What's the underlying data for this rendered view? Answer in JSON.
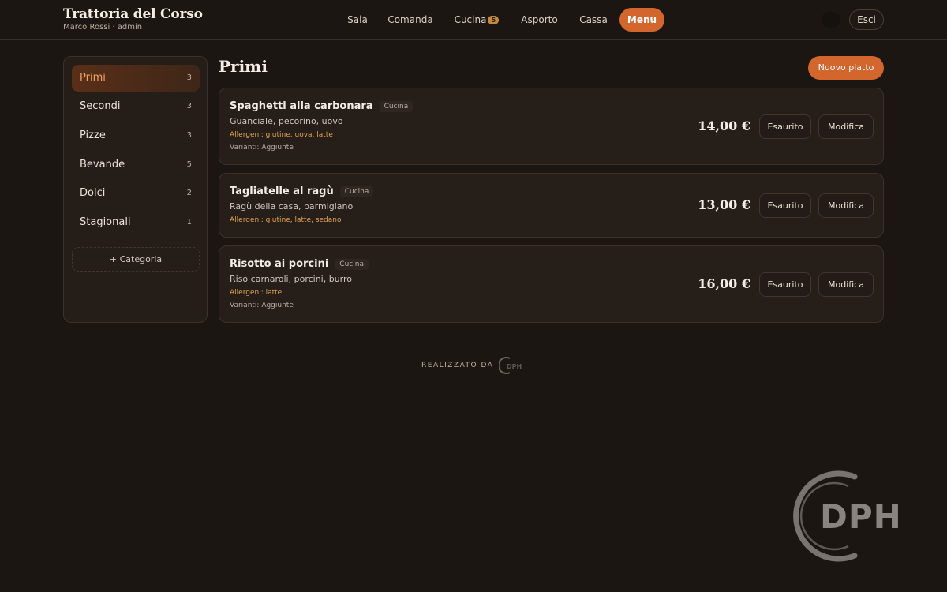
{
  "header": {
    "title": "Trattoria del Corso",
    "subtitle": "Marco Rossi · admin",
    "nav": [
      {
        "label": "Sala"
      },
      {
        "label": "Comanda"
      },
      {
        "label": "Cucina",
        "badge": "5"
      },
      {
        "label": "Asporto"
      },
      {
        "label": "Cassa"
      },
      {
        "label": "Menu",
        "active": true
      }
    ],
    "logout_label": "Esci"
  },
  "sidebar": {
    "categories": [
      {
        "label": "Primi",
        "count": "3",
        "active": true
      },
      {
        "label": "Secondi",
        "count": "3"
      },
      {
        "label": "Pizze",
        "count": "3"
      },
      {
        "label": "Bevande",
        "count": "5"
      },
      {
        "label": "Dolci",
        "count": "2"
      },
      {
        "label": "Stagionali",
        "count": "1"
      }
    ],
    "add_label": "+ Categoria"
  },
  "main": {
    "title": "Primi",
    "new_button": "Nuovo piatto",
    "dishes": [
      {
        "name": "Spaghetti alla carbonara",
        "tag": "Cucina",
        "description": "Guanciale, pecorino, uovo",
        "allergens": "Allergeni: glutine, uova, latte",
        "variants": "Varianti: Aggiunte",
        "price": "14,00 €",
        "sold_out_label": "Esaurito",
        "edit_label": "Modifica"
      },
      {
        "name": "Tagliatelle al ragù",
        "tag": "Cucina",
        "description": "Ragù della casa, parmigiano",
        "allergens": "Allergeni: glutine, latte, sedano",
        "variants": "",
        "price": "13,00 €",
        "sold_out_label": "Esaurito",
        "edit_label": "Modifica"
      },
      {
        "name": "Risotto ai porcini",
        "tag": "Cucina",
        "description": "Riso carnaroli, porcini, burro",
        "allergens": "Allergeni: latte",
        "variants": "Varianti: Aggiunte",
        "price": "16,00 €",
        "sold_out_label": "Esaurito",
        "edit_label": "Modifica"
      }
    ]
  },
  "footer": {
    "credit": "REALIZZATO DA",
    "logo_text": "DPH"
  },
  "watermark": {
    "text": "DPH"
  },
  "colors": {
    "accent": "#d2662d",
    "background": "#1c1612",
    "card": "#251e19",
    "allergen": "#e1a24a"
  }
}
